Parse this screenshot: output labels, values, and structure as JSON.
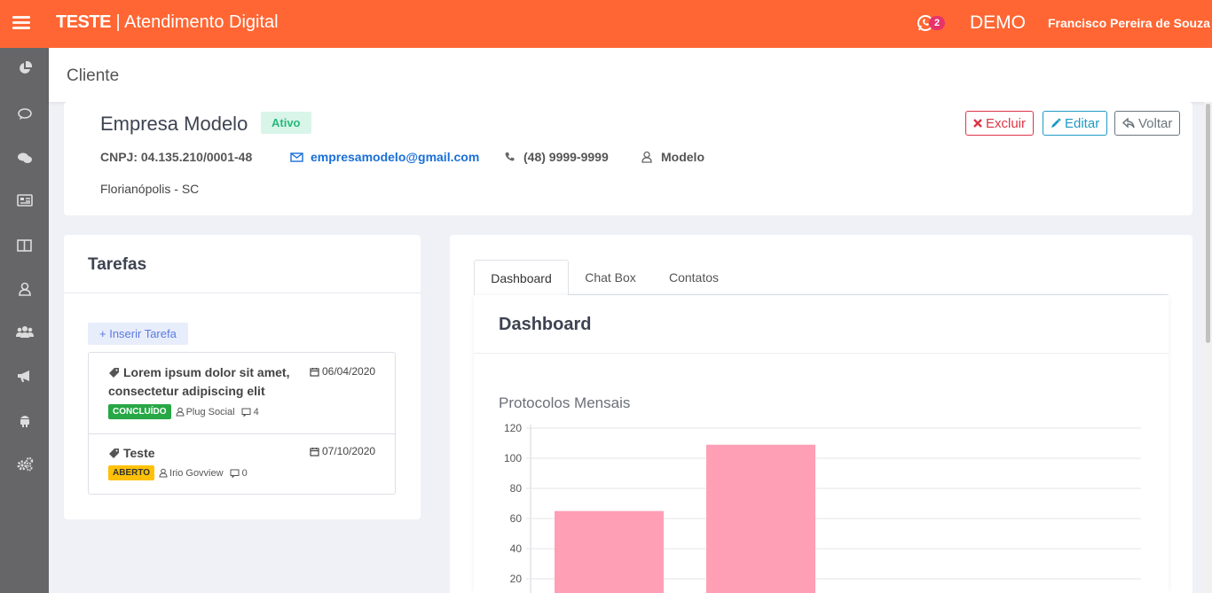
{
  "topbar": {
    "brand_bold": "TESTE",
    "brand_rest": " | Atendimento Digital",
    "whatsapp_badge": "2",
    "env": "DEMO",
    "user": "Francisco Pereira de Souza",
    "color": "#ff6633"
  },
  "sidebar": {
    "icons": [
      "pie-chart-icon",
      "comment-icon",
      "comments-icon",
      "newspaper-icon",
      "columns-icon",
      "user-icon",
      "users-icon",
      "bullhorn-icon",
      "android-icon",
      "cogs-icon"
    ]
  },
  "page": {
    "title": "Cliente"
  },
  "client": {
    "name": "Empresa Modelo",
    "status": "Ativo",
    "buttons": {
      "delete": "Excluir",
      "edit": "Editar",
      "back": "Voltar"
    },
    "cnpj": "CNPJ:  04.135.210/0001-48",
    "email": "empresamodelo@gmail.com",
    "phone": "(48) 9999-9999",
    "contact": "Modelo",
    "city": "Florianópolis - SC"
  },
  "tasks": {
    "title": "Tarefas",
    "add_label": "+ Inserir Tarefa",
    "items": [
      {
        "title": "Lorem ipsum dolor sit amet, consectetur adipiscing elit",
        "date": "06/04/2020",
        "status": "CONCLUÍDO",
        "assignee": "Plug Social",
        "comments": "4"
      },
      {
        "title": "Teste",
        "date": "07/10/2020",
        "status": "ABERTO",
        "assignee": "Irio Govview",
        "comments": "0"
      }
    ]
  },
  "tabs": [
    {
      "label": "Dashboard",
      "active": true
    },
    {
      "label": "Chat Box",
      "active": false
    },
    {
      "label": "Contatos",
      "active": false
    }
  ],
  "dashboard": {
    "title": "Dashboard",
    "chart_title": "Protocolos Mensais"
  },
  "chart_data": {
    "type": "bar",
    "title": "Protocolos Mensais",
    "categories": [
      "",
      ""
    ],
    "values": [
      65,
      109
    ],
    "yticks": [
      20,
      40,
      60,
      80,
      100,
      120
    ],
    "ylim": [
      0,
      120
    ],
    "grid": true,
    "bar_color": "#ff9fb5"
  }
}
